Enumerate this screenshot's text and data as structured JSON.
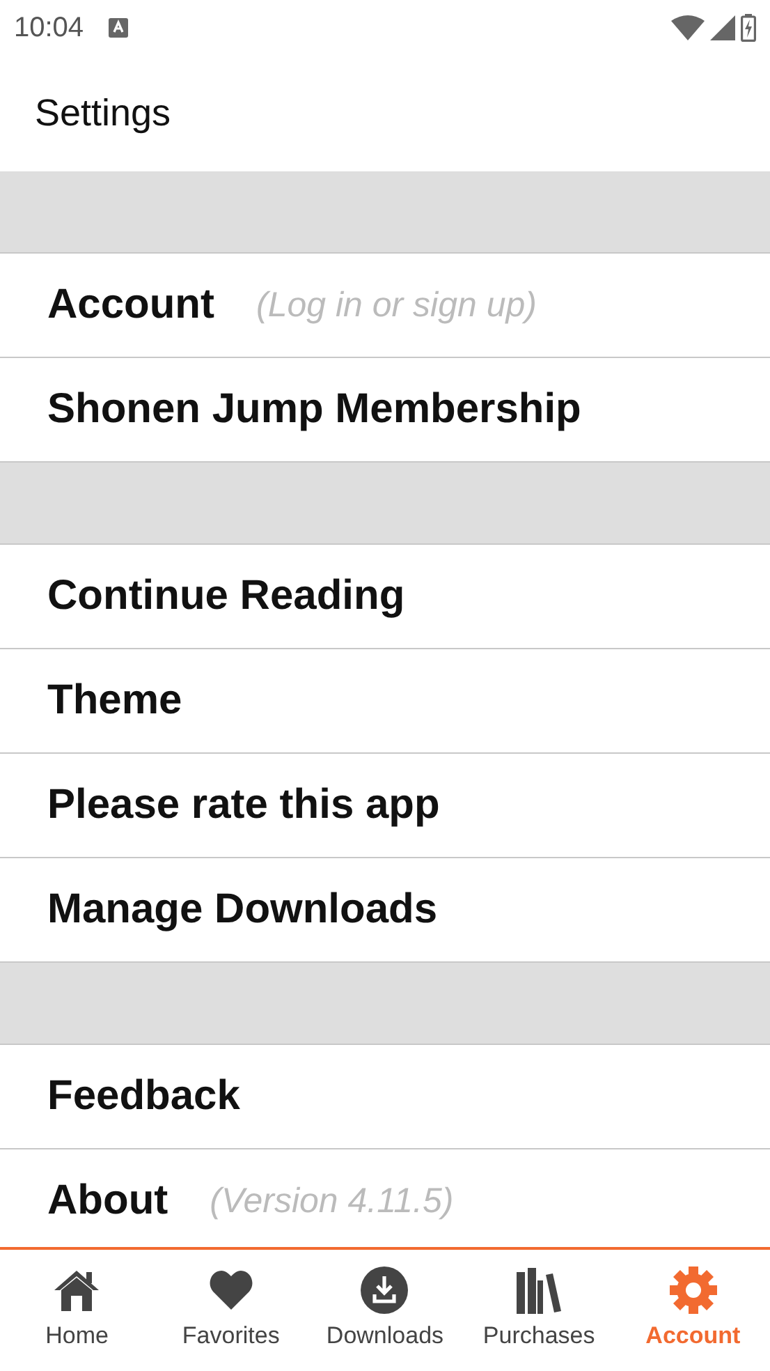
{
  "status_bar": {
    "time": "10:04"
  },
  "header": {
    "title": "Settings"
  },
  "sections": [
    {
      "rows": [
        {
          "label": "Account",
          "hint": "(Log in or sign up)"
        },
        {
          "label": "Shonen Jump Membership"
        }
      ]
    },
    {
      "rows": [
        {
          "label": "Continue Reading"
        },
        {
          "label": "Theme"
        },
        {
          "label": "Please rate this app"
        },
        {
          "label": "Manage Downloads"
        }
      ]
    },
    {
      "rows": [
        {
          "label": "Feedback"
        },
        {
          "label": "About",
          "hint": "(Version 4.11.5)"
        }
      ]
    }
  ],
  "bottom_nav": [
    {
      "kind": "home",
      "label": "Home",
      "selected": false
    },
    {
      "kind": "favorites",
      "label": "Favorites",
      "selected": false
    },
    {
      "kind": "downloads",
      "label": "Downloads",
      "selected": false
    },
    {
      "kind": "purchases",
      "label": "Purchases",
      "selected": false
    },
    {
      "kind": "account",
      "label": "Account",
      "selected": true
    }
  ]
}
